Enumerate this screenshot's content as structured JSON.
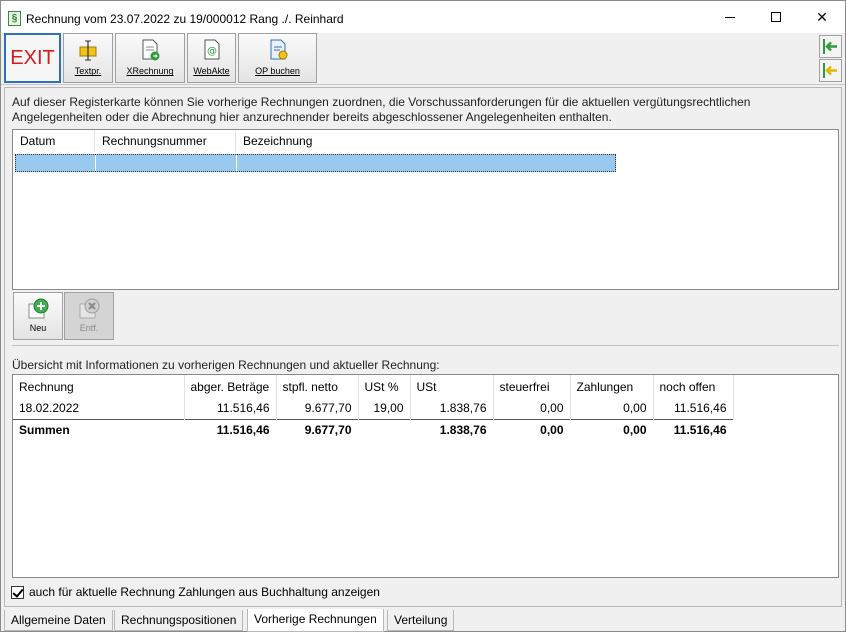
{
  "window": {
    "title": "Rechnung vom 23.07.2022 zu 19/000012  Rang ./. Reinhard",
    "app_icon": "§",
    "minimize": "",
    "maximize": "",
    "close": "✕"
  },
  "toolbar": {
    "exit": "EXIT",
    "textpr": "Textpr.",
    "xrechnung": "XRechnung",
    "webakte": "WebAkte",
    "op_buchen": "OP buchen"
  },
  "info_text": "Auf dieser Registerkarte können Sie vorherige Rechnungen zuordnen, die Vorschussanforderungen für die aktuellen vergütungsrechtlichen Angelegenheiten oder die Abrechnung hier anzurechnender bereits abgeschlossener Angelegenheiten enthalten.",
  "list1": {
    "columns": [
      "Datum",
      "Rechnungsnummer",
      "Bezeichnung"
    ]
  },
  "buttons": {
    "neu": "Neu",
    "entf": "Entf."
  },
  "overview_label": "Übersicht mit Informationen zu vorherigen Rechnungen und aktueller Rechnung:",
  "list2": {
    "columns": [
      "Rechnung",
      "abger. Beträge",
      "stpfl. netto",
      "USt %",
      "USt",
      "steuerfrei",
      "Zahlungen",
      "noch offen"
    ],
    "rows": [
      [
        "18.02.2022",
        "11.516,46",
        "9.677,70",
        "19,00",
        "1.838,76",
        "0,00",
        "0,00",
        "11.516,46"
      ]
    ],
    "sum": [
      "Summen",
      "11.516,46",
      "9.677,70",
      "",
      "1.838,76",
      "0,00",
      "0,00",
      "11.516,46"
    ]
  },
  "checkbox_label": "auch für aktuelle Rechnung Zahlungen aus Buchhaltung anzeigen",
  "tabs": [
    "Allgemeine Daten",
    "Rechnungspositionen",
    "Vorherige Rechnungen",
    "Verteilung"
  ],
  "colors": {
    "exit_red": "#d41a1a",
    "selection": "#99c9ef",
    "accent_green": "#2e9a3a"
  }
}
